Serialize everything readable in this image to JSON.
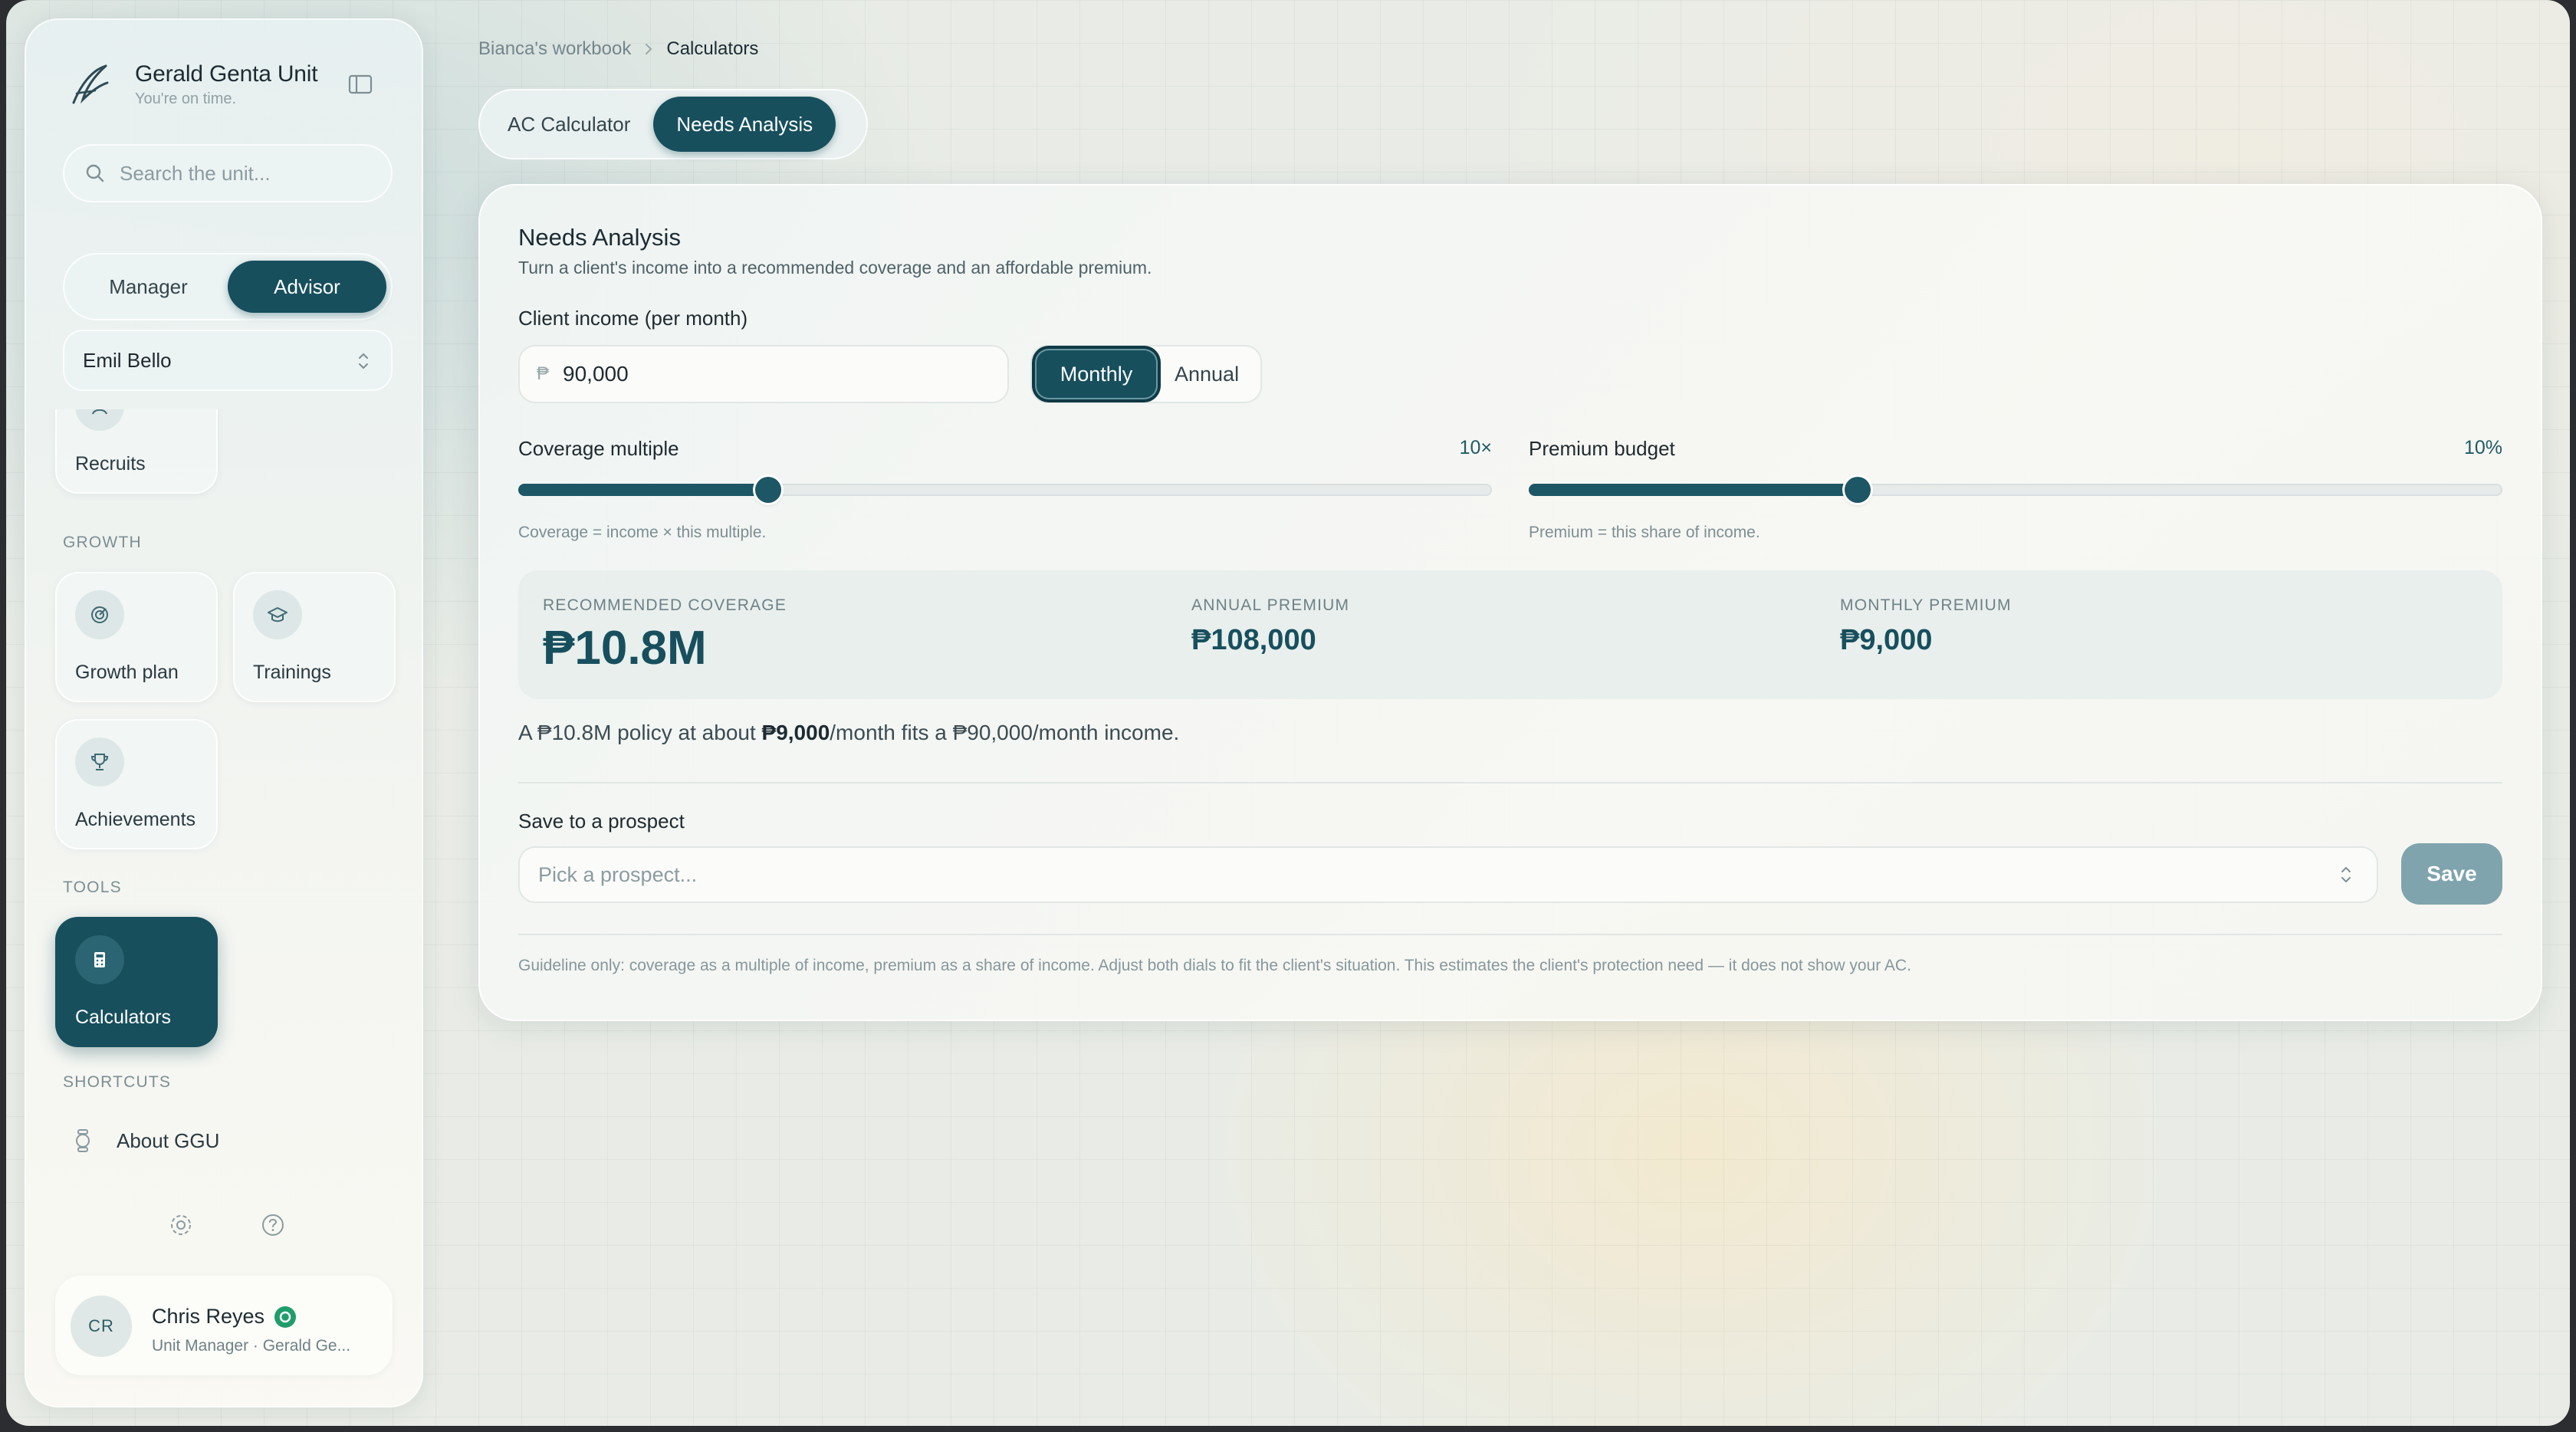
{
  "sidebar": {
    "brand_name": "Gerald Genta Unit",
    "brand_tagline": "You're on time.",
    "search_placeholder": "Search the unit...",
    "roles": [
      "Manager",
      "Advisor"
    ],
    "active_role": "Advisor",
    "selected_advisor": "Emil Bello",
    "tiles": {
      "recruits": "Recruits",
      "growth_plan": "Growth plan",
      "trainings": "Trainings",
      "achievements": "Achievements",
      "calculators": "Calculators"
    },
    "sections": {
      "growth": "GROWTH",
      "tools": "TOOLS",
      "shortcuts": "SHORTCUTS"
    },
    "shortcut_about": "About GGU",
    "user": {
      "initials": "CR",
      "name": "Chris Reyes",
      "role": "Unit Manager · Gerald Ge..."
    }
  },
  "breadcrumb": {
    "parent": "Bianca's workbook",
    "current": "Calculators"
  },
  "calculator_tabs": [
    "AC Calculator",
    "Needs Analysis"
  ],
  "active_calculator_tab": "Needs Analysis",
  "needs_analysis": {
    "title": "Needs Analysis",
    "subtitle": "Turn a client's income into a recommended coverage and an affordable premium.",
    "income_label": "Client income (per month)",
    "currency_prefix": "₱",
    "income_value": "90,000",
    "frequency_options": [
      "Monthly",
      "Annual"
    ],
    "active_frequency": "Monthly",
    "coverage_multiple": {
      "label": "Coverage multiple",
      "value_text": "10×",
      "value": 10,
      "slider_fraction": 0.257,
      "hint": "Coverage = income × this multiple."
    },
    "premium_budget": {
      "label": "Premium budget",
      "value_text": "10%",
      "value": 10,
      "slider_fraction": 0.338,
      "hint": "Premium = this share of income."
    },
    "results": {
      "recommended_coverage_label": "RECOMMENDED COVERAGE",
      "recommended_coverage": "₱10.8M",
      "annual_premium_label": "ANNUAL PREMIUM",
      "annual_premium": "₱108,000",
      "monthly_premium_label": "MONTHLY PREMIUM",
      "monthly_premium": "₱9,000"
    },
    "summary_pre": "A ₱10.8M policy at about ",
    "summary_bold": "₱9,000",
    "summary_post": "/month fits a ₱90,000/month income.",
    "save_label": "Save to a prospect",
    "prospect_placeholder": "Pick a prospect...",
    "save_button": "Save",
    "guideline": "Guideline only: coverage as a multiple of income, premium as a share of income. Adjust both dials to fit the client's situation. This estimates the client's protection need — it does not show your AC."
  },
  "colors": {
    "accent": "#174f5d",
    "save_button": "#7fa4ad",
    "verified_badge": "#1f9d6b"
  }
}
